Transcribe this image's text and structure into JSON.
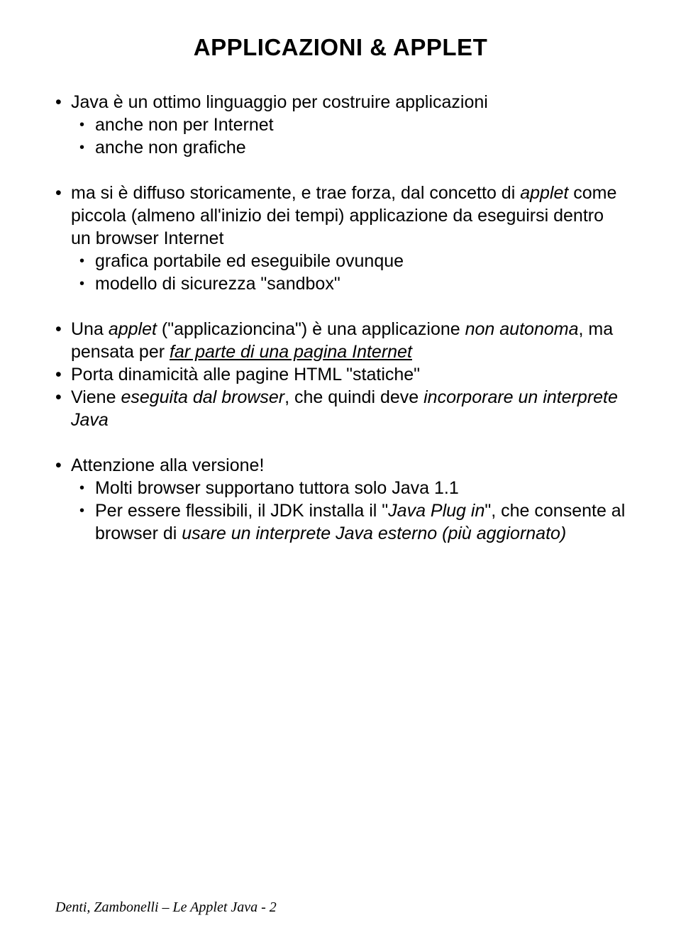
{
  "title": "APPLICAZIONI & APPLET",
  "block1": {
    "l1": "Java è un ottimo linguaggio per costruire applicazioni",
    "s1": "anche non per Internet",
    "s2": "anche non grafiche"
  },
  "block2": {
    "l1_pre": "ma si è diffuso storicamente, e trae forza, dal concetto di ",
    "l1_em": "applet",
    "l1_post": " come piccola (almeno all'inizio dei tempi) applicazione da eseguirsi dentro un browser Internet",
    "s1": "grafica portabile ed eseguibile ovunque",
    "s2": "modello di sicurezza \"sandbox\""
  },
  "block3": {
    "i1_a": "Una ",
    "i1_b": "applet",
    "i1_c": " (\"applicazioncina\") è una applicazione ",
    "i1_d": "non autonoma",
    "i1_e": ", ma pensata per ",
    "i1_f": "far parte di una pagina Internet",
    "i2": "Porta dinamicità alle pagine HTML \"statiche\"",
    "i3_a": "Viene ",
    "i3_b": "eseguita dal browser",
    "i3_c": ", che quindi deve ",
    "i3_d": "incorporare un interprete Java"
  },
  "block4": {
    "l1": "Attenzione alla versione!",
    "s1": "Molti browser supportano tuttora solo Java 1.1",
    "s2_a": "Per essere flessibili, il JDK installa il \"",
    "s2_b": "Java Plug in",
    "s2_c": "\", che consente al browser di ",
    "s2_d": "usare un interprete Java esterno (più aggiornato)"
  },
  "footer": "Denti, Zambonelli – Le Applet Java - 2"
}
